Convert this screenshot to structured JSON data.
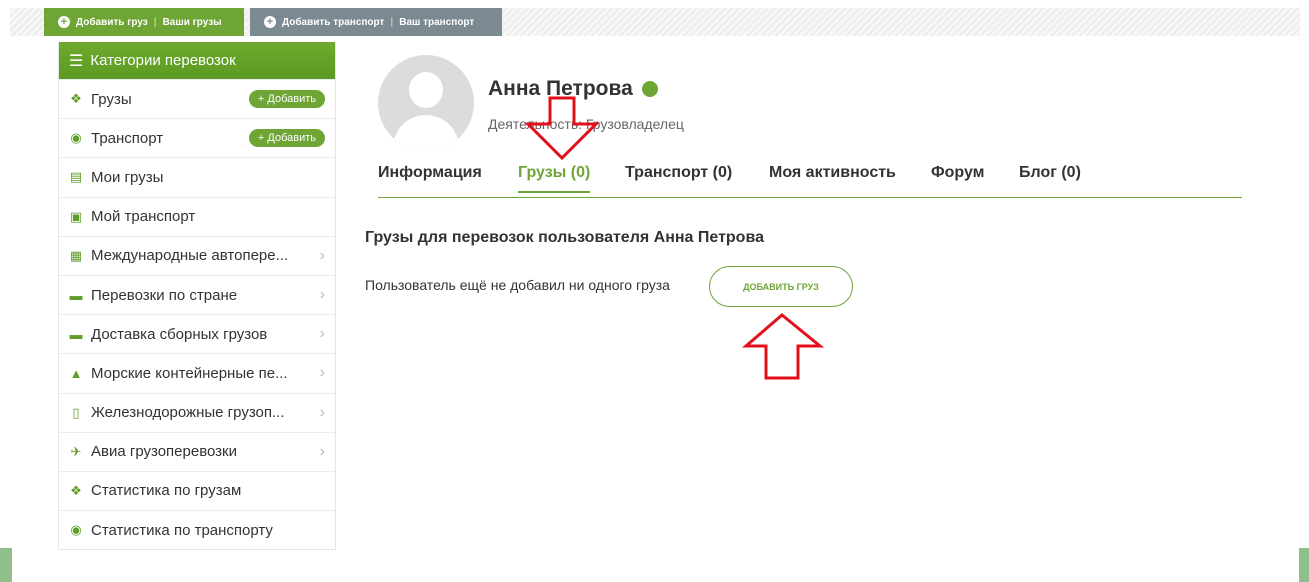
{
  "topbar": {
    "add_cargo": "Добавить груз",
    "your_cargo": "Ваши грузы",
    "add_transport": "Добавить транспорт",
    "your_transport": "Ваш транспорт"
  },
  "sidebar": {
    "header": "Категории перевозок",
    "items": [
      {
        "label": "Грузы",
        "icon": "cargo-box-icon",
        "button": "+ Добавить"
      },
      {
        "label": "Транспорт",
        "icon": "steering-wheel-icon",
        "button": "+ Добавить"
      },
      {
        "label": "Мои грузы",
        "icon": "clipboard-icon"
      },
      {
        "label": "Мой транспорт",
        "icon": "trucks-icon"
      },
      {
        "label": "Международные автопере...",
        "icon": "truck-front-icon"
      },
      {
        "label": "Перевозки по стране",
        "icon": "truck-icon"
      },
      {
        "label": "Доставка сборных грузов",
        "icon": "delivery-truck-icon"
      },
      {
        "label": "Морские контейнерные пе...",
        "icon": "ship-icon"
      },
      {
        "label": "Железнодорожные грузоп...",
        "icon": "train-icon"
      },
      {
        "label": "Авиа грузоперевозки",
        "icon": "plane-icon"
      },
      {
        "label": "Статистика по грузам",
        "icon": "cargo-box-icon"
      },
      {
        "label": "Статистика по транспорту",
        "icon": "steering-wheel-icon"
      }
    ]
  },
  "profile": {
    "name": "Анна Петрова",
    "activity": "Деятельность: Грузовладелец"
  },
  "tabs": [
    {
      "label": "Информация",
      "active": false
    },
    {
      "label": "Грузы (0)",
      "active": true
    },
    {
      "label": "Транспорт (0)",
      "active": false
    },
    {
      "label": "Моя активность",
      "active": false
    },
    {
      "label": "Форум",
      "active": false
    },
    {
      "label": "Блог (0)",
      "active": false
    }
  ],
  "main": {
    "section_title": "Грузы для перевозок пользователя Анна Петрова",
    "empty_text": "Пользователь ещё не добавил ни одного груза",
    "add_button": "ДОБАВИТЬ ГРУЗ"
  },
  "colors": {
    "accent": "#6ea535",
    "topbar_gray": "#7b8a91",
    "annotation_red": "#e3101b"
  }
}
